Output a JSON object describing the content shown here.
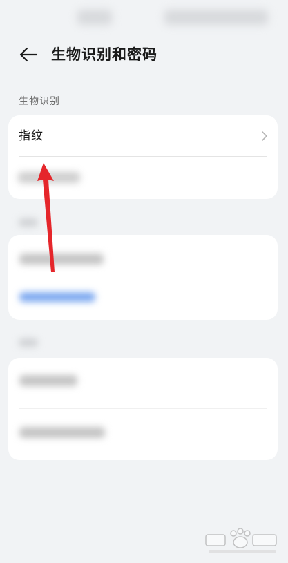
{
  "header": {
    "back_icon": "back-arrow-icon",
    "title": "生物识别和密码"
  },
  "biometrics": {
    "section_label": "生物识别",
    "items": [
      {
        "label": "指纹",
        "icon": "chevron-right-icon"
      }
    ]
  },
  "colors": {
    "background": "#f1f3f5",
    "card": "#ffffff",
    "annotation_arrow": "#e5262b",
    "link_blue": "#7aa7f0"
  }
}
